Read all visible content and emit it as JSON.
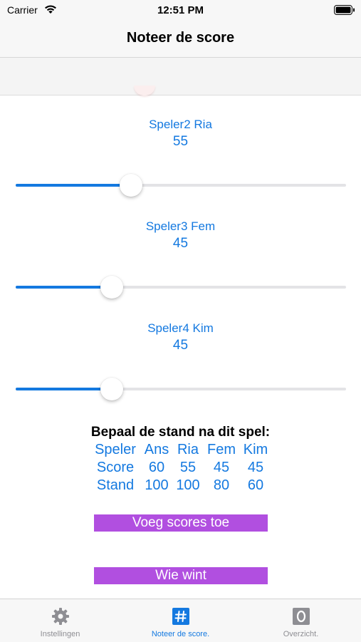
{
  "status": {
    "carrier": "Carrier",
    "time": "12:51 PM"
  },
  "nav": {
    "title": "Noteer de score"
  },
  "players": [
    {
      "label": "Speler2 Ria",
      "score": "55",
      "slider_fraction": 0.35
    },
    {
      "label": "Speler3 Fem",
      "score": "45",
      "slider_fraction": 0.29
    },
    {
      "label": "Speler4 Kim",
      "score": "45",
      "slider_fraction": 0.29
    }
  ],
  "stand": {
    "heading": "Bepaal de stand na dit spel:",
    "rows": [
      [
        "Speler",
        "Ans",
        "Ria",
        "Fem",
        "Kim"
      ],
      [
        "Score",
        "60",
        "55",
        "45",
        "45"
      ],
      [
        "Stand",
        "100",
        "100",
        "80",
        "60"
      ]
    ]
  },
  "buttons": {
    "add_scores": "Voeg scores toe",
    "who_wins": "Wie wint"
  },
  "tabs": [
    {
      "label": "Instellingen",
      "icon": "gear-icon"
    },
    {
      "label": "Noteer de score.",
      "icon": "hash-icon",
      "active": true
    },
    {
      "label": "Overzicht.",
      "icon": "o-icon"
    }
  ],
  "colors": {
    "accent": "#1479e0",
    "button": "#b14fe0"
  }
}
